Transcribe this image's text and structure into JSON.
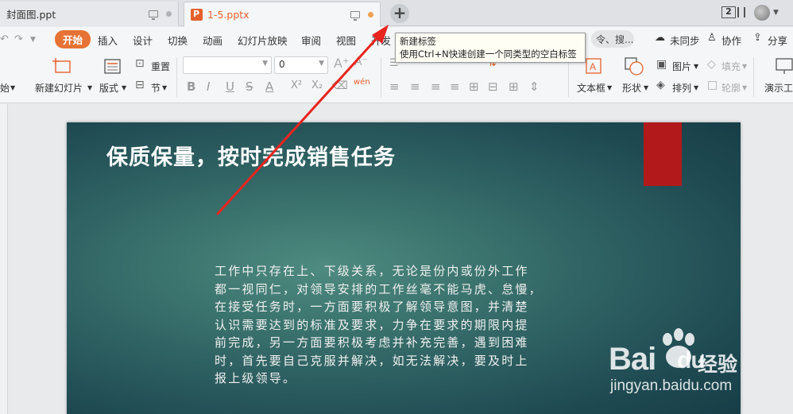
{
  "tabs": [
    {
      "label": "封面图.ppt"
    },
    {
      "label": "1-5.pptx"
    }
  ],
  "new_tab_button": "+",
  "window_badge": "2",
  "tooltip": {
    "title": "新建标签",
    "desc": "使用Ctrl+N快速创建一个同类型的空白标签"
  },
  "menu": {
    "items": [
      "开始",
      "插入",
      "设计",
      "切换",
      "动画",
      "幻灯片放映",
      "审阅",
      "视图",
      "开发"
    ],
    "search_text": "令、搜...",
    "right": {
      "sync": "未同步",
      "collab": "协作",
      "share": "分享"
    }
  },
  "ribbon": {
    "start_label": "始",
    "new_slide": "新建幻灯片",
    "layout": "版式",
    "reset": "重置",
    "section": "节",
    "font_size_value": "0",
    "format_buttons": [
      "B",
      "I",
      "U",
      "S",
      "A",
      "X²",
      "X₂"
    ],
    "textbox": "文本框",
    "shape": "形状",
    "picture": "图片",
    "arrange": "排列",
    "fill": "填充",
    "outline": "轮廓",
    "presenter": "演示工",
    "wen": "wén"
  },
  "slide": {
    "title": "保质保量，按时完成销售任务",
    "body_lines": [
      "工作中只存在上、下级关系，无论是份内或份外工作",
      "都一视同仁，对领导安排的工作丝毫不能马虎、怠慢，",
      "在接受任务时，一方面要积极了解领导意图，并清楚",
      "认识需要达到的标准及要求，力争在要求的期限内提",
      "前完成，另一方面要积极考虑并补充完善，遇到困难",
      "时，首先要自己克服并解决，如无法解决，要及时上",
      "报上级领导。"
    ]
  },
  "watermark": {
    "brand": "Bai",
    "brand2": "du",
    "cn": "经验",
    "url": "jingyan.baidu.com"
  },
  "colors": {
    "accent_orange": "#e67333",
    "unsaved_dot": "#f0a050",
    "arrow_red": "#e8241e",
    "slide_red": "#b1191a"
  }
}
